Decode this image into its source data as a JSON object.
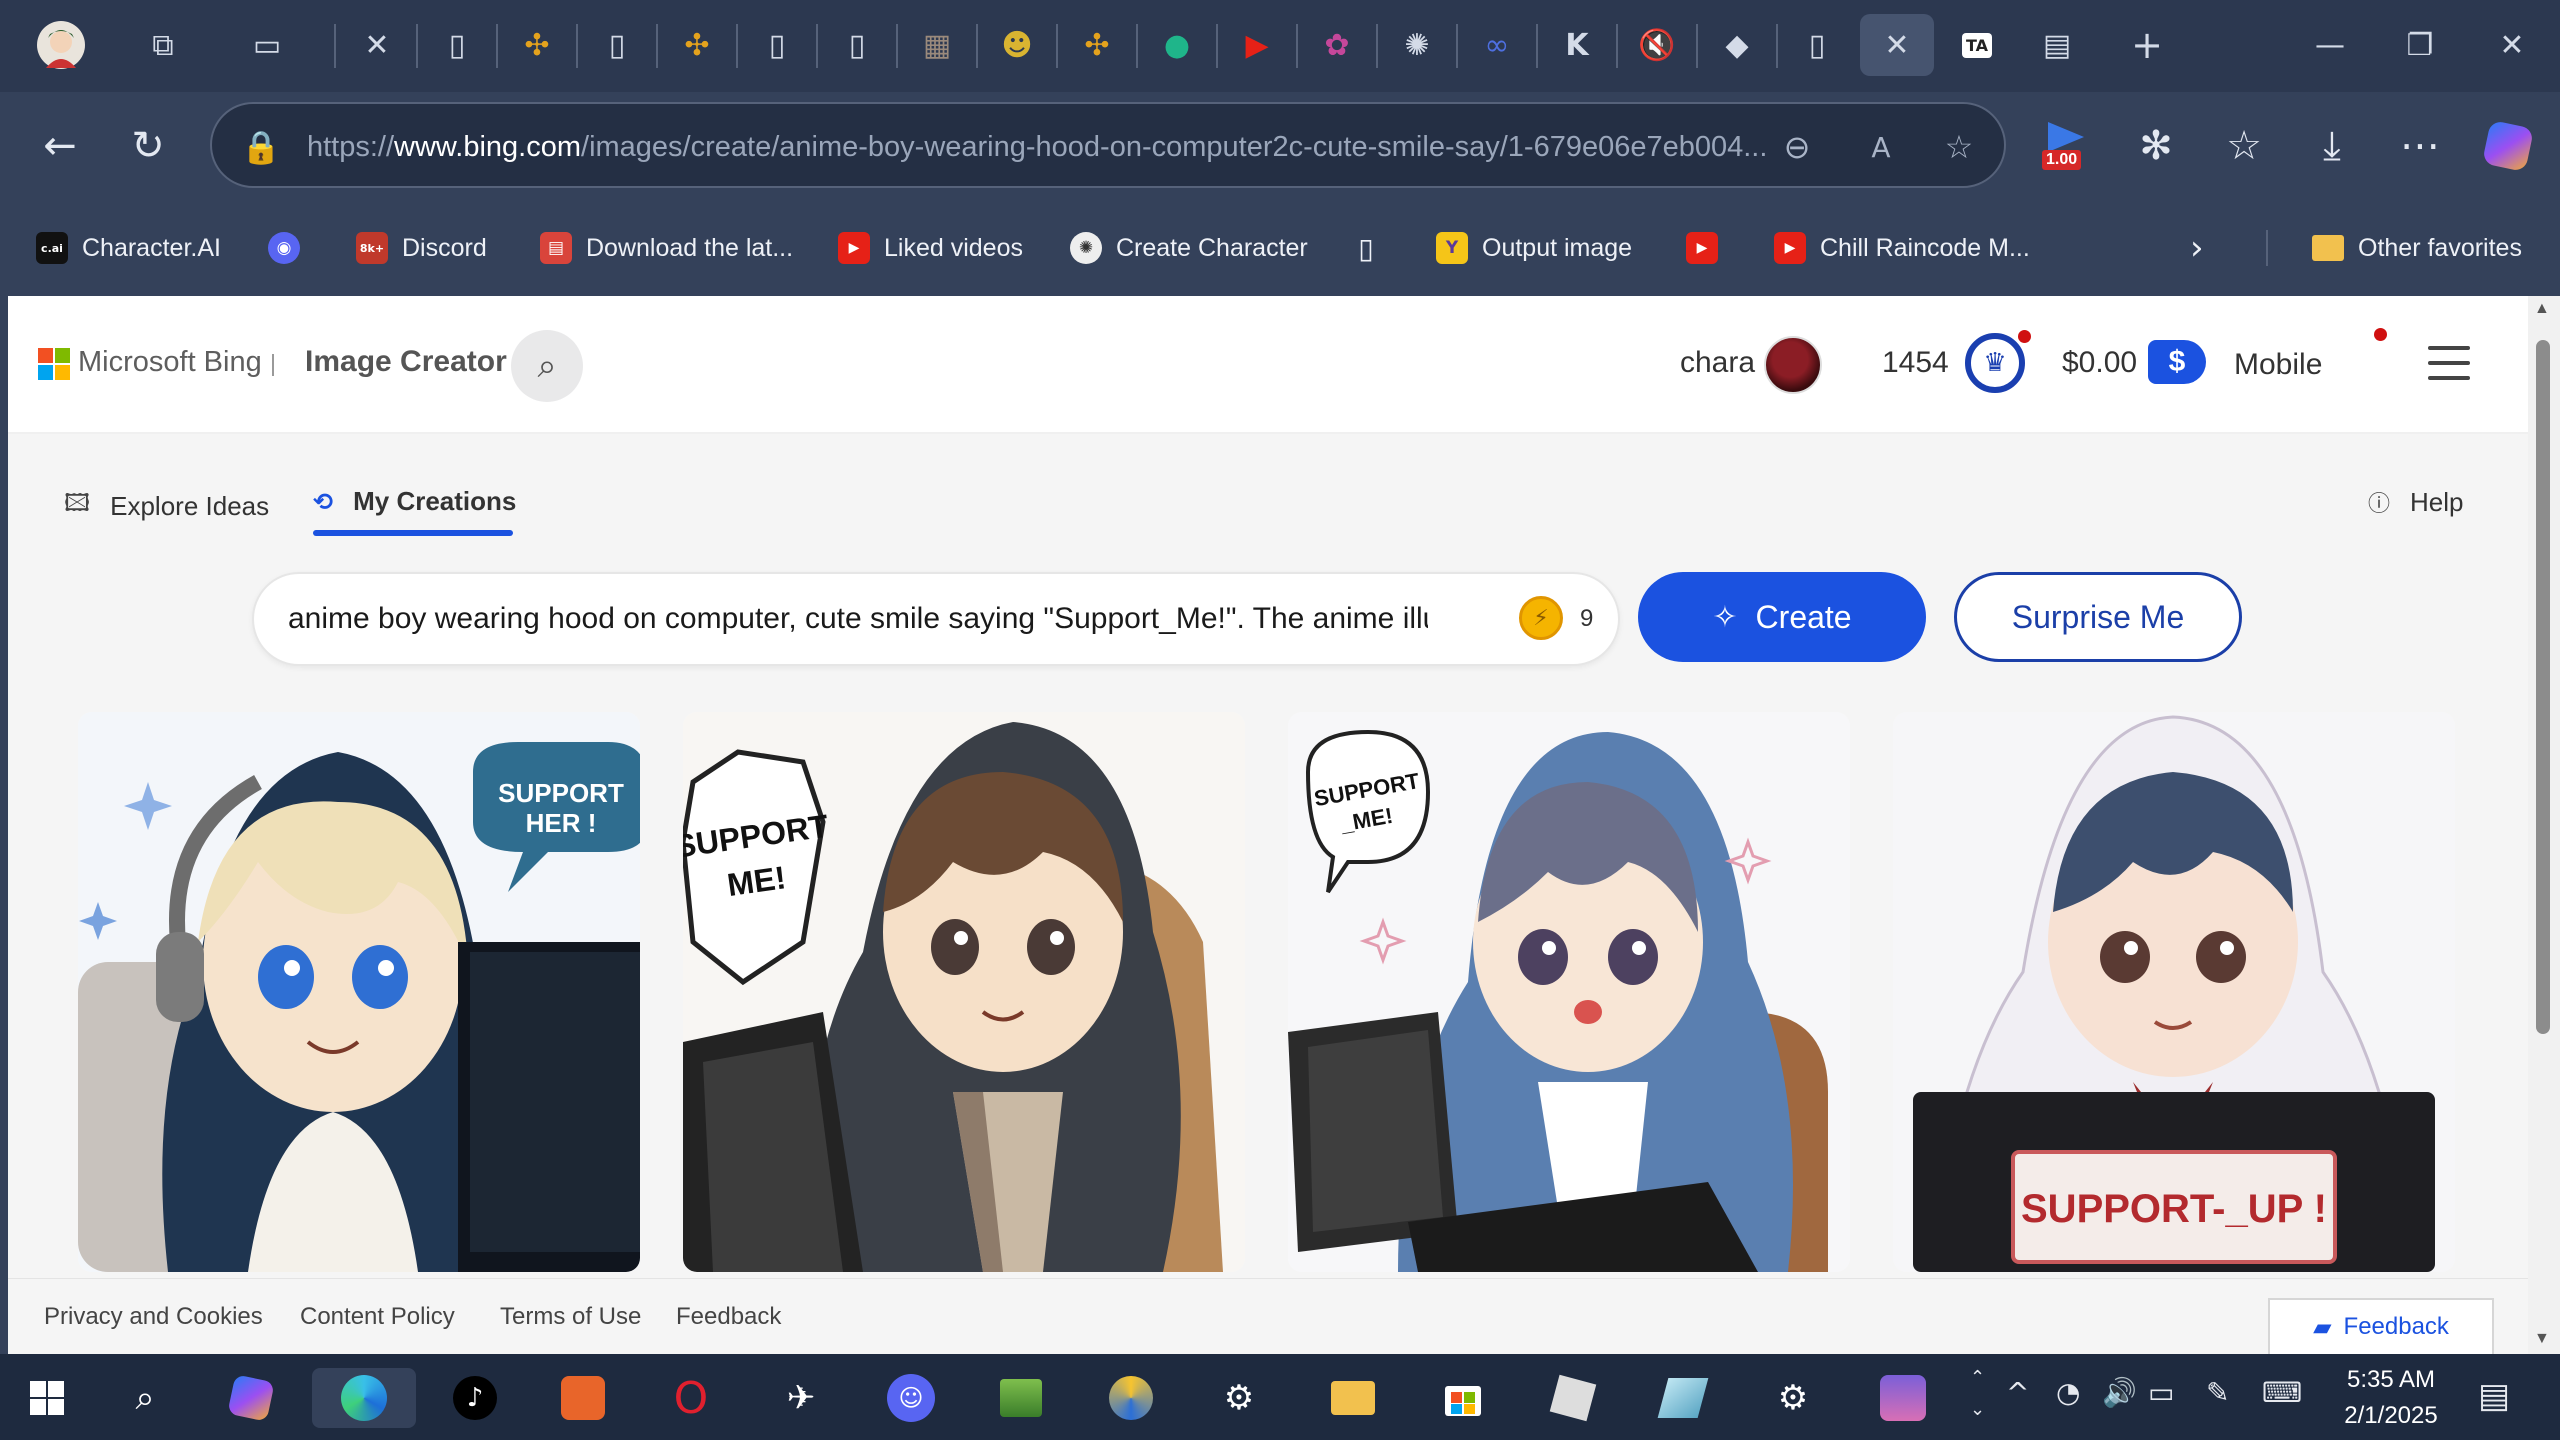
{
  "browser": {
    "url_prefix": "https://",
    "url_domain": "www.bing.com",
    "url_rest": "/images/create/anime-boy-wearing-hood-on-computer2c-cute-smile-say/1-679e06e7eb004...",
    "extension_badge": "1.00",
    "favorites": [
      {
        "label": "Character.AI",
        "icon_text": "c.ai",
        "color": "#111111"
      },
      {
        "label": "",
        "icon_text": "◉",
        "color": "#5865f2"
      },
      {
        "label": "Discord",
        "icon_text": "8k+",
        "color": "#c0392b"
      },
      {
        "label": "Download the lat...",
        "icon_text": "▤",
        "color": "#d9443b"
      },
      {
        "label": "Liked videos",
        "icon_text": "▶",
        "color": "#e62117"
      },
      {
        "label": "Create Character",
        "icon_text": "✺",
        "color": "#eeeeee"
      },
      {
        "label": "",
        "icon_text": "▯",
        "color": "#34415a"
      },
      {
        "label": "Output image",
        "icon_text": "Y",
        "color": "#f5c518"
      },
      {
        "label": "",
        "icon_text": "▶",
        "color": "#e62117"
      },
      {
        "label": "Chill Raincode M...",
        "icon_text": "▶",
        "color": "#e62117"
      }
    ],
    "other_favorites": "Other favorites"
  },
  "header": {
    "brand": "Microsoft Bing",
    "product": "Image Creator",
    "username": "chara",
    "points": "1454",
    "balance": "$0.00",
    "balance_icon": "$",
    "mobile": "Mobile"
  },
  "tabs": {
    "explore": "Explore Ideas",
    "creations": "My Creations",
    "help": "Help"
  },
  "prompt": {
    "text": "anime boy wearing hood on computer, cute smile saying \"Support_Me!\". The anime illustration",
    "boost_count": "9",
    "create_label": "Create",
    "surprise_label": "Surprise Me"
  },
  "images": [
    {
      "bubble": "SUPPORT HER !",
      "hood": "#1f3550",
      "bg": "#f3f6fa"
    },
    {
      "bubble": "SUPPORT ME!",
      "hood": "#3a3f47",
      "bg": "#f8f6f3"
    },
    {
      "bubble": "SUPPORT _ME!",
      "hood": "#5a7fb0",
      "bg": "#f7f7f9"
    },
    {
      "bubble": "SUPPORT-_UP !",
      "hood": "#f1eff4",
      "bg": "#f6f6f8"
    }
  ],
  "footer": {
    "privacy": "Privacy and Cookies",
    "content_policy": "Content Policy",
    "terms": "Terms of Use",
    "feedback": "Feedback",
    "feedback_float": "Feedback"
  },
  "taskbar": {
    "time": "5:35 AM",
    "date": "2/1/2025"
  },
  "colors": {
    "accent": "#1b52e0",
    "chrome": "#34415a"
  }
}
